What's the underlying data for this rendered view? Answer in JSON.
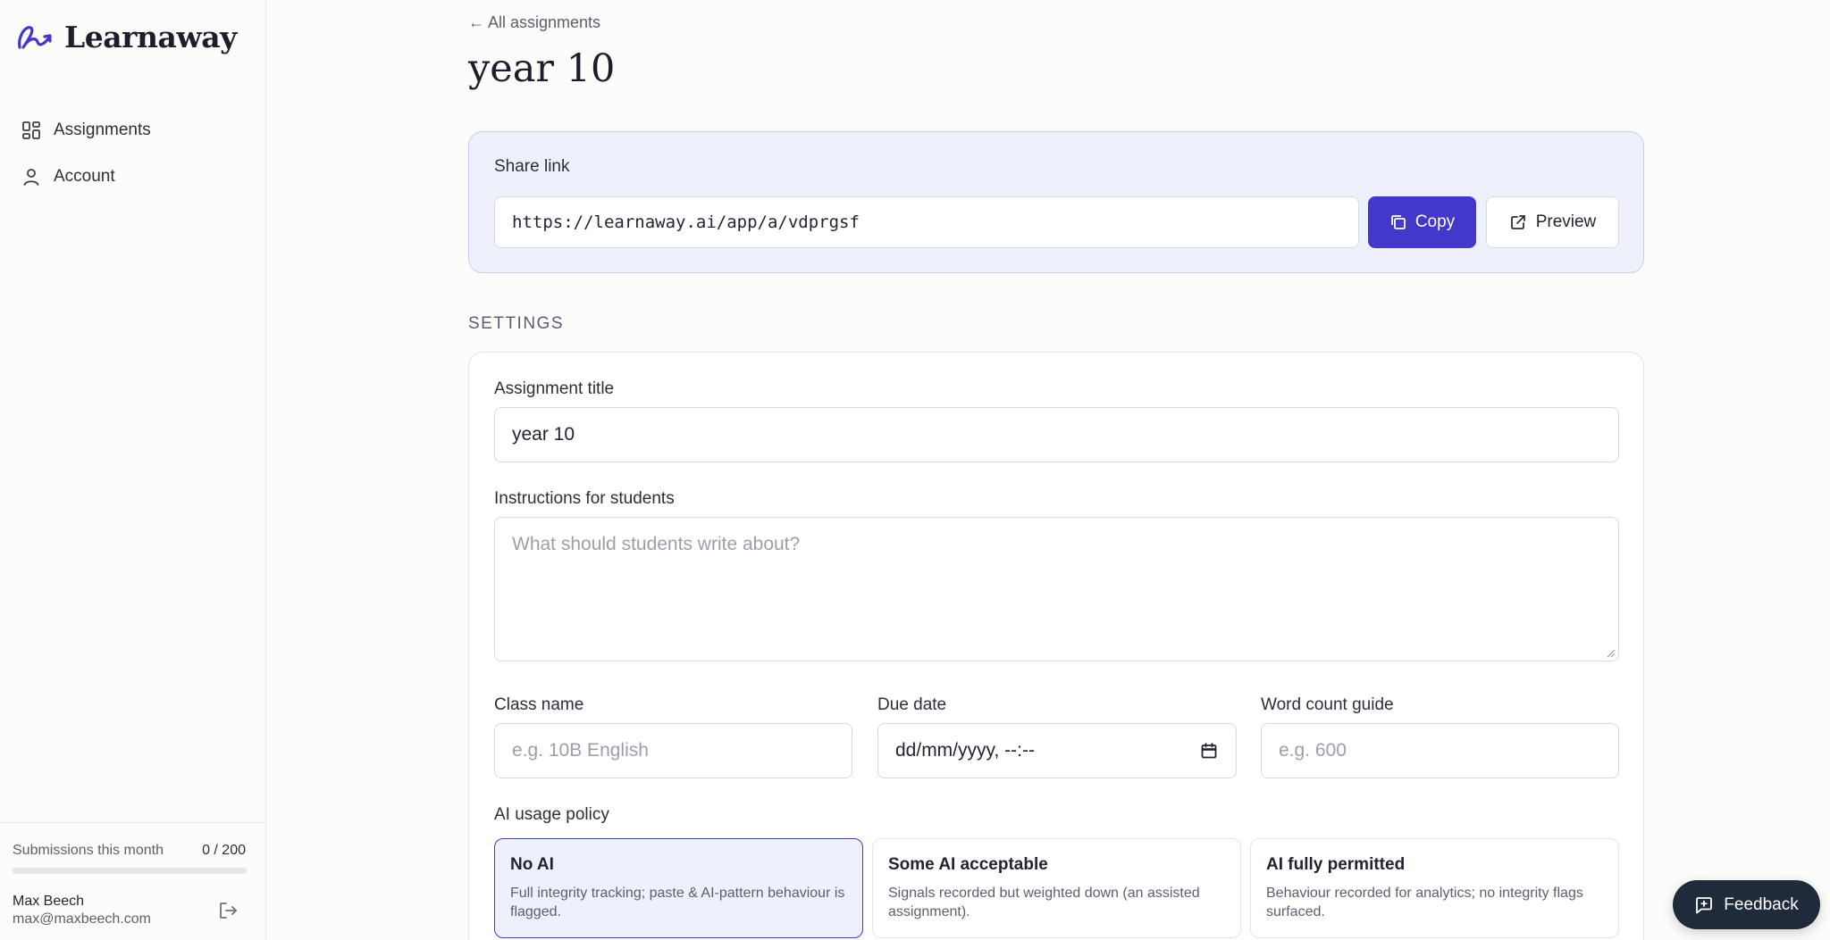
{
  "brand": {
    "name": "Learnaway",
    "accent": "#4338ca",
    "logo_icon": "learnaway-logo-icon"
  },
  "sidebar": {
    "items": [
      {
        "label": "Assignments",
        "icon": "grid-icon"
      },
      {
        "label": "Account",
        "icon": "user-icon"
      }
    ],
    "usage": {
      "label": "Submissions this month",
      "count": "0 / 200",
      "used": 0,
      "limit": 200
    },
    "user": {
      "name": "Max Beech",
      "email": "max@maxbeech.com"
    }
  },
  "main": {
    "back_link": "← All assignments",
    "title": "year 10",
    "share": {
      "label": "Share link",
      "url": "https://learnaway.ai/app/a/vdprgsf",
      "copy_label": "Copy",
      "preview_label": "Preview"
    },
    "settings_heading": "SETTINGS",
    "settings": {
      "title_label": "Assignment title",
      "title_value": "year 10",
      "instructions_label": "Instructions for students",
      "instructions_placeholder": "What should students write about?",
      "class_label": "Class name",
      "class_placeholder": "e.g. 10B English",
      "due_label": "Due date",
      "due_value": "dd/mm/yyyy, --:--",
      "wordcount_label": "Word count guide",
      "wordcount_placeholder": "e.g. 600",
      "ai_policy_label": "AI usage policy",
      "ai_policies": [
        {
          "title": "No AI",
          "description": "Full integrity tracking; paste & AI-pattern behaviour is flagged.",
          "selected": true
        },
        {
          "title": "Some AI acceptable",
          "description": "Signals recorded but weighted down (an assisted assignment).",
          "selected": false
        },
        {
          "title": "AI fully permitted",
          "description": "Behaviour recorded for analytics; no integrity flags surfaced.",
          "selected": false
        }
      ]
    }
  },
  "feedback_label": "Feedback"
}
